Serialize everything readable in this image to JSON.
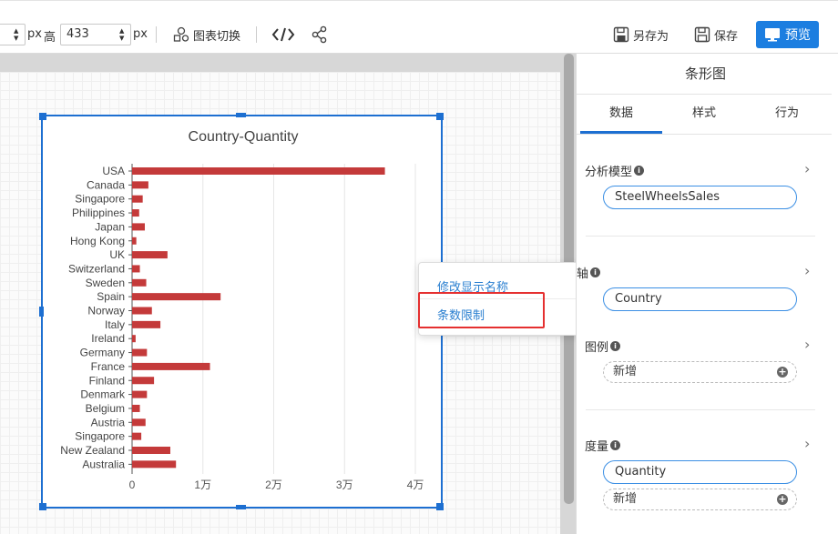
{
  "toolbar": {
    "width_unit": "px",
    "height_label": "高",
    "height_value": "433",
    "height_unit": "px",
    "chart_switch": "图表切换",
    "save_as": "另存为",
    "save": "保存",
    "preview": "预览"
  },
  "context_menu": {
    "rename": "修改显示名称",
    "limit": "条数限制"
  },
  "panel": {
    "title": "条形图",
    "tabs": [
      "数据",
      "样式",
      "行为"
    ],
    "model_label": "分析模型",
    "model_value": "SteelWheelsSales",
    "axis_label": "轴",
    "axis_value": "Country",
    "legend_label": "图例",
    "legend_add": "新增",
    "measure_label": "度量",
    "measure_value": "Quantity",
    "measure_add": "新增"
  },
  "colors": {
    "bar": "#c43a3a",
    "accent": "#1c7ee0",
    "highlight": "#e53030"
  },
  "chart_data": {
    "type": "bar",
    "orientation": "horizontal",
    "title": "Country-Quantity",
    "categories": [
      "USA",
      "Canada",
      "Singapore",
      "Philippines",
      "Japan",
      "Hong Kong",
      "UK",
      "Switzerland",
      "Sweden",
      "Spain",
      "Norway",
      "Italy",
      "Ireland",
      "Germany",
      "France",
      "Finland",
      "Denmark",
      "Belgium",
      "Austria",
      "Singapore",
      "New Zealand",
      "Australia"
    ],
    "values": [
      35700,
      2300,
      1500,
      1000,
      1800,
      600,
      5000,
      1100,
      2000,
      12500,
      2800,
      4000,
      500,
      2100,
      11000,
      3100,
      2100,
      1100,
      1900,
      1300,
      5400,
      6200
    ],
    "xticks": [
      0,
      10000,
      20000,
      30000,
      40000
    ],
    "xtick_labels": [
      "0",
      "1万",
      "2万",
      "3万",
      "4万"
    ],
    "xlim": [
      0,
      40000
    ],
    "grid": true
  }
}
